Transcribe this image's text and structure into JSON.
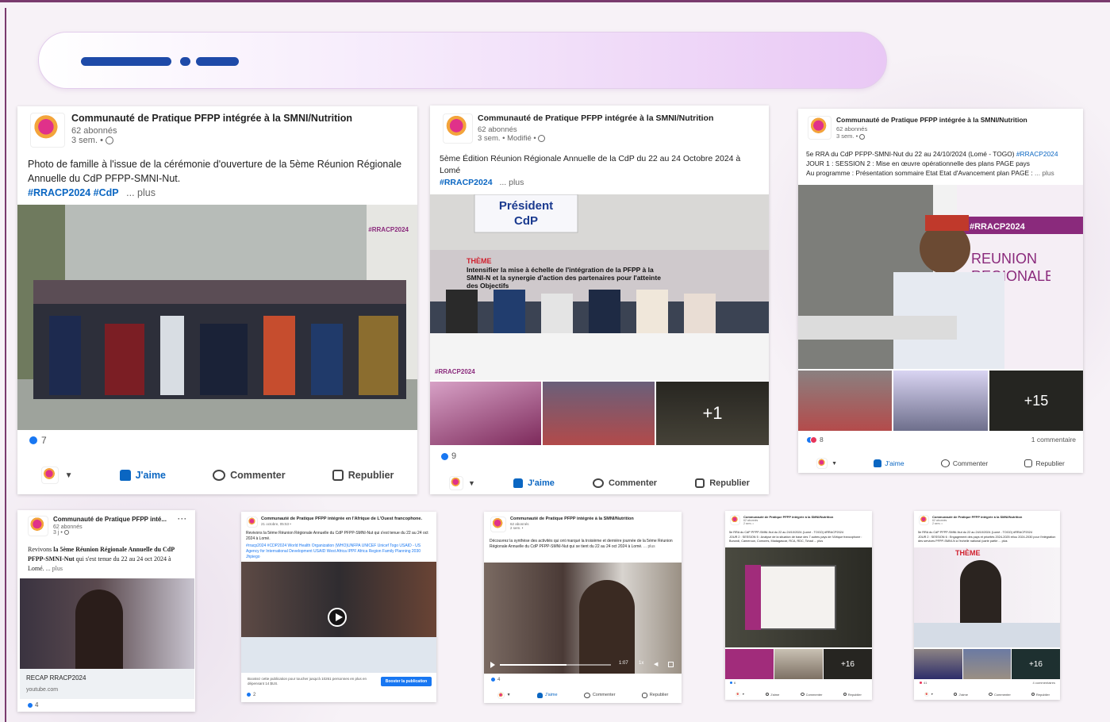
{
  "org_name": "Communauté de Pratique PFPP intégrée à la SMNI/Nutrition",
  "org_name_short": "Communauté de Pratique PFPP inté...",
  "org_name_west": "Communauté de Pratique PFPP intégrée en l'Afrique de L'Ouest francophone.",
  "followers": "62 abonnés",
  "actions": {
    "like": "J'aime",
    "comment": "Commenter",
    "repost": "Republier"
  },
  "post1": {
    "meta": "3 sem. •",
    "text": "Photo de famille à l'issue de la cérémonie d'ouverture de la 5ème Réunion Régionale Annuelle du CdP PFPP-SMNI-Nut.",
    "tags": "#RRACP2024 #CdP",
    "more": "... plus",
    "reactions": "7",
    "watermark": "#RRACP2024"
  },
  "post2": {
    "meta": "3 sem. • Modifié •",
    "text": "5ème Édition Réunion Régionale Annuelle de la CdP du 22 au 24 Octobre 2024 à Lomé",
    "tags": "#RRACP2024",
    "more": "... plus",
    "reactions": "9",
    "sign_top": "Président",
    "sign_bottom": "CdP",
    "theme": "THÈME",
    "banner": "Intensifier la mise à échelle de l'intégration de la PFPP à la SMNI-N et la synergie d'action des partenaires pour l'atteinte des Objectifs",
    "watermark": "#RRACP2024",
    "plus_count": "+1"
  },
  "post3": {
    "meta": "3 sem. •",
    "line1": "5e RRA du CdP PFPP-SMNI-Nut du 22 au 24/10/2024 (Lomé - TOGO)",
    "line1_tag": "#RRACP2024",
    "line2": "JOUR 1 : SESSION 2 : Mise en œuvre opérationnelle des plans PAGE pays",
    "line3": "Au programme : Présentation sommaire Etat Etat d'Avancement plan PAGE :",
    "more": "... plus",
    "reactions": "8",
    "comments": "1 commentaire",
    "hashtag_wall": "#RRACP2024",
    "reunion": "REUNION REGIONALE",
    "plus_count": "+15"
  },
  "post4": {
    "meta": "3 j •",
    "text_pre": "Revivons ",
    "text_bold": "la 5ème Réunion Régionale Annuelle du CdP PFPP-SMNI-Nut",
    "text_post": " qui s'est tenue du 22 au 24 oct 2024 à Lomé.",
    "more": "... plus",
    "link_title": "RECAP RRACP2024",
    "link_domain": "youtube.com",
    "reactions": "4"
  },
  "post5": {
    "meta": "21 octobre, 05:53 •",
    "text": "Revivons la 5ème Réunion Régionale Annuelle du CdP PFPP-SMNI-Nut qui s'est tenue du 22 au 24 oct 2024 à Lomé.",
    "tags": "#rracp2024 #CDP2024 World Health Organization (WHO)UNFPA UNICEF Unicef Togo USAID - US Agency for International Development USAID West Africa IPPF Africa Region Family Planning 2030 Jhpiego",
    "boost_text": "Boostez cette publication pour toucher jusqu'à 10261 personnes en plus en dépensant 14 $US.",
    "boost_button": "Booster la publication",
    "reactions": "2"
  },
  "post6": {
    "meta": "2 sem. •",
    "text": "Découvrez la synthèse des activités qui ont marqué la troisième et dernière journée de la 5ème Réunion Régionale Annuelle du CdP PFPP-SMNI-Nut qui se tient du 22 au 24 oct 2024 à Lomé.",
    "more": "... plus",
    "video_time": "1:07",
    "video_speed": "1x",
    "reactions": "4"
  },
  "post7": {
    "meta": "2 sem. •",
    "line1": "5e RRA du CdP PFPP-SMNI-Nut du 22 au 24/10/2024 (Lomé - TOGO) #RRACP2024",
    "line2": "JOUR 2 : SESSION 5 : Analyse de la situation de base des 7 autres pays de l'Afrique francophone : Burundi, Cameroun, Comores, Madagascar, RCA, RDC, Tchad ... plus",
    "plus_count": "+16",
    "reactions": "6"
  },
  "post8": {
    "meta": "2 sem. •",
    "line1": "5e RRA du CdP PFPP-SMNI-Nut du 22 au 24/10/2024 (Lomé - TOGO) #RRACP2024",
    "line2": "JOUR 2 : SESSION 6 : Engagement des pays et priorités 2024-2025 et/ou 2024-2030 pour l'intégration des services PFPP-SMNI-N à l'échelle national (carte partie ... plus",
    "theme": "THÈME",
    "plus_count": "+16",
    "reactions": "41",
    "comments": "4 commentaires"
  }
}
